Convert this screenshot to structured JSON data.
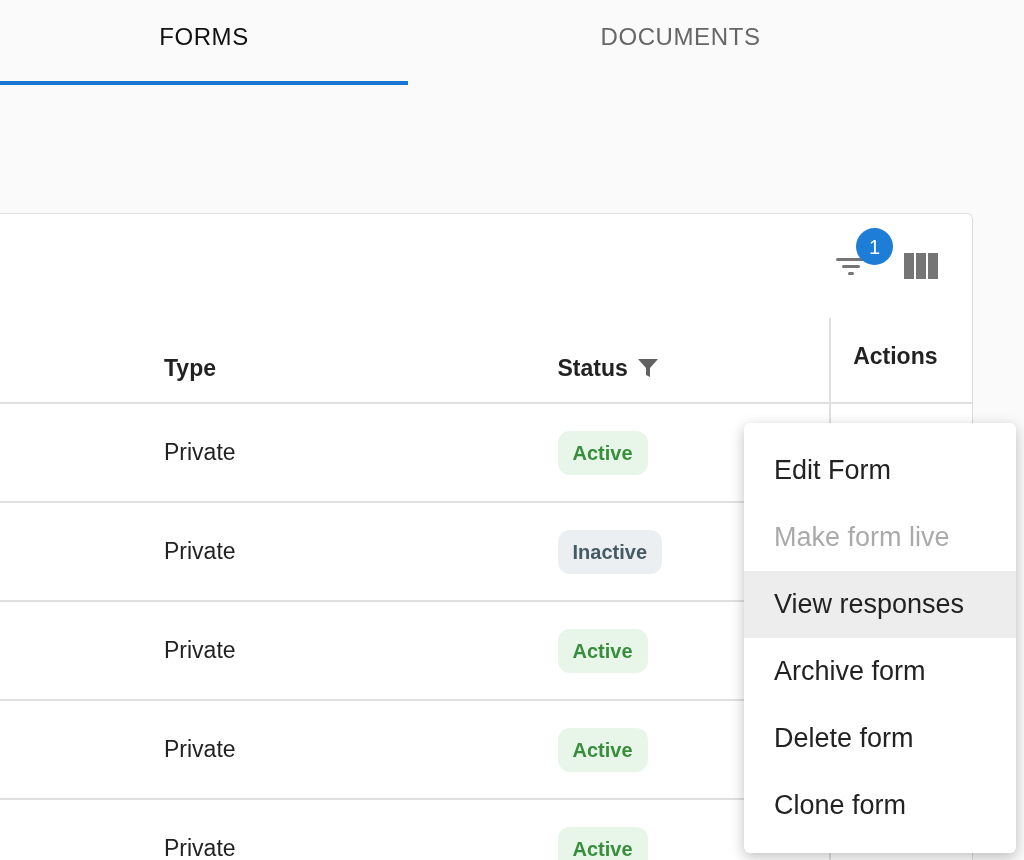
{
  "tabs": [
    {
      "label": "FORMS",
      "selected": true
    },
    {
      "label": "DOCUMENTS",
      "selected": false
    }
  ],
  "toolbar": {
    "filter_badge": "1"
  },
  "table": {
    "columns": [
      {
        "label": "Type",
        "filtered": false
      },
      {
        "label": "Status",
        "filtered": true
      },
      {
        "label": "Actions",
        "filtered": false
      }
    ],
    "rows": [
      {
        "type": "Private",
        "status": {
          "label": "Active",
          "kind": "active"
        }
      },
      {
        "type": "Private",
        "status": {
          "label": "Inactive",
          "kind": "inactive"
        }
      },
      {
        "type": "Private",
        "status": {
          "label": "Active",
          "kind": "active"
        }
      },
      {
        "type": "Private",
        "status": {
          "label": "Active",
          "kind": "active"
        }
      },
      {
        "type": "Private",
        "status": {
          "label": "Active",
          "kind": "active"
        }
      }
    ]
  },
  "menu": [
    {
      "label": "Edit Form",
      "disabled": false,
      "selected": false
    },
    {
      "label": "Make form live",
      "disabled": true,
      "selected": false
    },
    {
      "label": "View responses",
      "disabled": false,
      "selected": true
    },
    {
      "label": "Archive form",
      "disabled": false,
      "selected": false
    },
    {
      "label": "Delete form",
      "disabled": false,
      "selected": false
    },
    {
      "label": "Clone form",
      "disabled": false,
      "selected": false
    }
  ]
}
